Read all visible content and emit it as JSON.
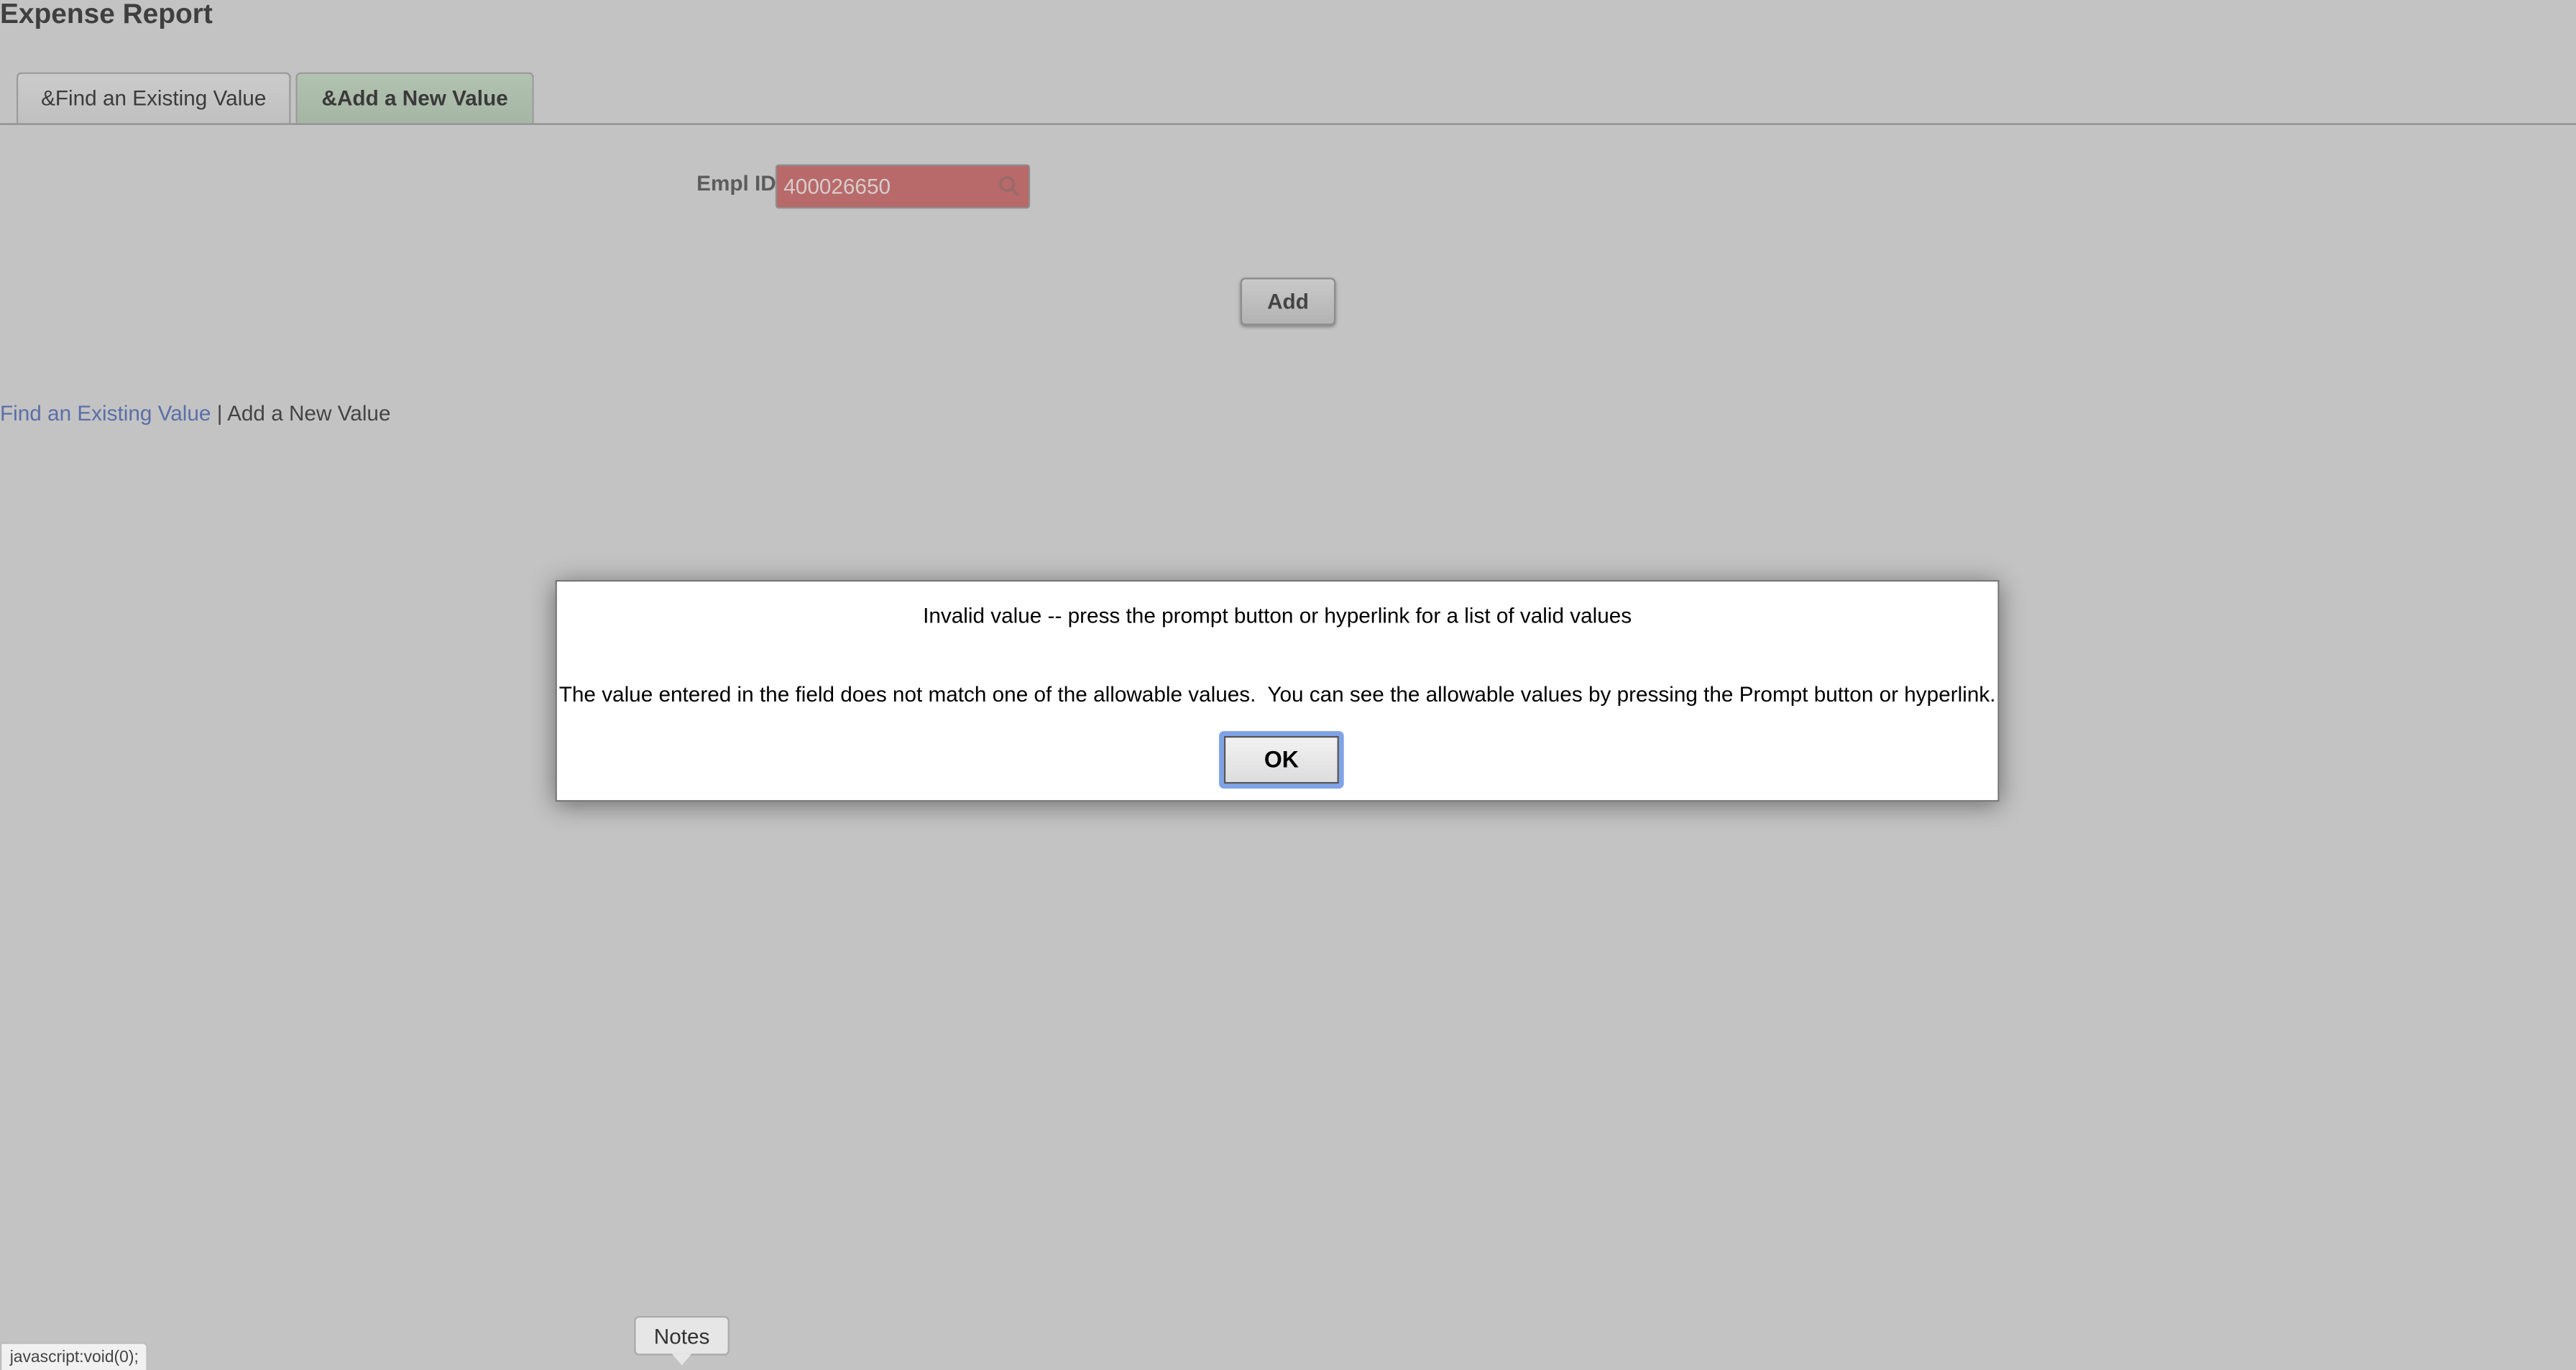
{
  "page": {
    "title": "Expense Report"
  },
  "tabs": [
    {
      "label": "&Find an Existing Value",
      "active": false
    },
    {
      "label": "&Add a New Value",
      "active": true
    }
  ],
  "form": {
    "empl_id_label": "Empl ID",
    "empl_id_value": "400026650",
    "empl_id_state": "invalid",
    "add_button_label": "Add",
    "lookup_icon": "search-icon"
  },
  "links": {
    "find_existing": "Find an Existing Value",
    "separator": " | ",
    "add_new": "Add a New Value"
  },
  "dialog": {
    "title": "Invalid value -- press the prompt button or hyperlink for a list of valid values",
    "message": "The value entered in the field does not match one of the allowable values.  You can see the allowable values by pressing the Prompt button or hyperlink.",
    "ok_label": "OK"
  },
  "status_bar": {
    "text": "javascript:void(0);"
  },
  "notes": {
    "label": "Notes"
  },
  "colors": {
    "background": "#c3c3c3",
    "active_tab": "#a6b6a4",
    "invalid_field": "#b86a6a",
    "link": "#5a6fa8",
    "focus_ring": "#7fa3e6"
  }
}
